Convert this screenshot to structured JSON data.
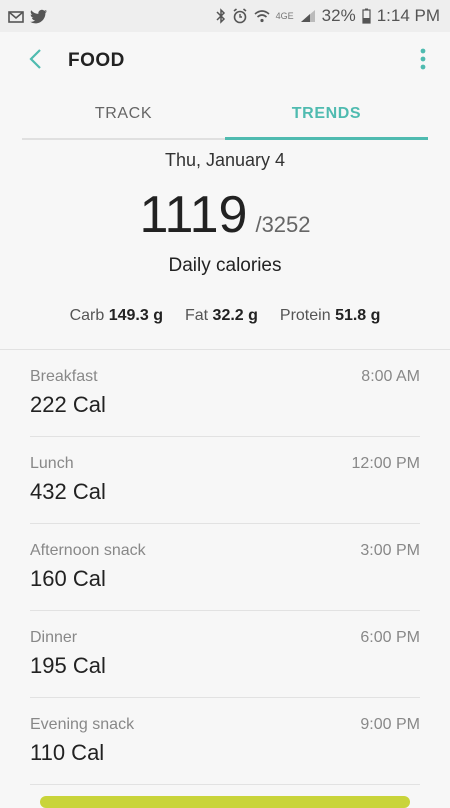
{
  "status": {
    "battery": "32%",
    "time": "1:14 PM",
    "network": "4GE"
  },
  "header": {
    "title": "FOOD"
  },
  "tabs": [
    {
      "label": "TRACK",
      "active": false
    },
    {
      "label": "TRENDS",
      "active": true
    }
  ],
  "summary": {
    "date": "Thu, January 4",
    "calories": "1119",
    "goal": "/3252",
    "label": "Daily calories",
    "macros": {
      "carb_label": "Carb",
      "carb_value": "149.3 g",
      "fat_label": "Fat",
      "fat_value": "32.2 g",
      "protein_label": "Protein",
      "protein_value": "51.8 g"
    }
  },
  "meals": [
    {
      "name": "Breakfast",
      "time": "8:00 AM",
      "calories": "222 Cal"
    },
    {
      "name": "Lunch",
      "time": "12:00 PM",
      "calories": "432 Cal"
    },
    {
      "name": "Afternoon snack",
      "time": "3:00 PM",
      "calories": "160 Cal"
    },
    {
      "name": "Dinner",
      "time": "6:00 PM",
      "calories": "195 Cal"
    },
    {
      "name": "Evening snack",
      "time": "9:00 PM",
      "calories": "110 Cal"
    }
  ],
  "colors": {
    "accent": "#4fbbb0",
    "bottom_button": "#c9d43a"
  }
}
